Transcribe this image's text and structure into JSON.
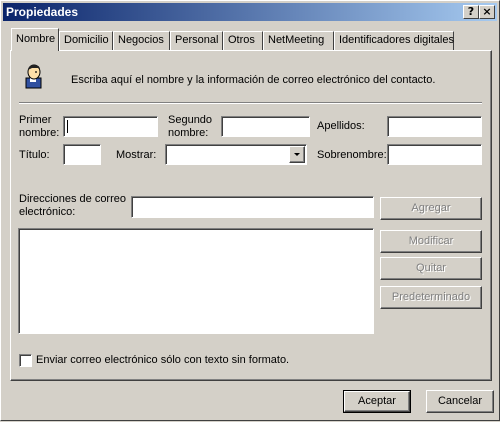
{
  "window": {
    "title": "Propiedades",
    "help_btn": "?",
    "close_btn": "×"
  },
  "tabs": [
    "Nombre",
    "Domicilio",
    "Negocios",
    "Personal",
    "Otros",
    "NetMeeting",
    "Identificadores digitales"
  ],
  "active_tab": "Nombre",
  "intro": {
    "text": "Escriba aquí el nombre y la información de correo electrónico del contacto.",
    "icon": "contact-person-icon"
  },
  "fields": {
    "first_name_label_1": "Primer",
    "first_name_label_2": "nombre:",
    "first_name_value": "",
    "middle_name_label_1": "Segundo",
    "middle_name_label_2": "nombre:",
    "middle_name_value": "",
    "last_name_label": "Apellidos:",
    "last_name_value": "",
    "title_label": "Título:",
    "title_value": "",
    "display_label": "Mostrar:",
    "display_value": "",
    "nickname_label": "Sobrenombre:",
    "nickname_value": ""
  },
  "email": {
    "label_1": "Direcciones de correo",
    "label_2": "electrónico:",
    "input_value": "",
    "list_items": [],
    "add_button": "Agregar",
    "modify_button": "Modificar",
    "remove_button": "Quitar",
    "default_button": "Predeterminado",
    "plain_text_checkbox": "Enviar correo electrónico sólo con texto sin formato.",
    "plain_text_checked": false
  },
  "footer": {
    "ok_button": "Aceptar",
    "cancel_button": "Cancelar"
  }
}
